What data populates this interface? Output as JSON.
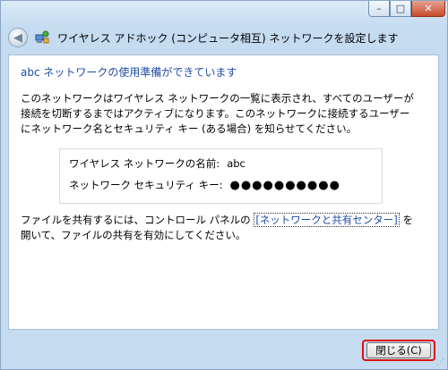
{
  "window": {
    "title": "ワイヤレス アドホック (コンピュータ相互) ネットワークを設定します",
    "controls": {
      "minimize": "–",
      "maximize": "□",
      "close": "✕"
    }
  },
  "nav": {
    "back_glyph": "◀"
  },
  "content": {
    "heading": "abc ネットワークの使用準備ができています",
    "paragraph": "このネットワークはワイヤレス ネットワークの一覧に表示され、すべてのユーザーが接続を切断するまではアクティブになります。このネットワークに接続するユーザーにネットワーク名とセキュリティ キー (ある場合) を知らせてください。",
    "info": {
      "name_label": "ワイヤレス ネットワークの名前:",
      "name_value": "abc",
      "key_label": "ネットワーク セキュリティ キー:",
      "key_value": "●●●●●●●●●●"
    },
    "sharing": {
      "before": "ファイルを共有するには、コントロール パネルの ",
      "link": "[ネットワークと共有センター]",
      "after": " を開いて、ファイルの共有を有効にしてください。"
    }
  },
  "footer": {
    "close_button": "閉じる(C)"
  },
  "colors": {
    "heading": "#1e4da5",
    "highlight": "#e01010"
  }
}
